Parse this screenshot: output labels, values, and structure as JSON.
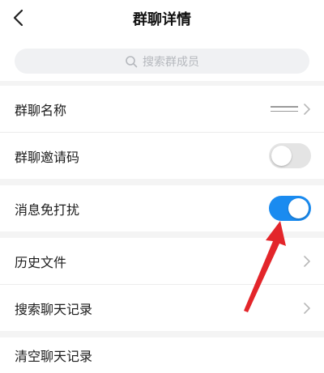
{
  "header": {
    "title": "群聊详情",
    "back_icon": "chevron-left-icon"
  },
  "search": {
    "placeholder": "搜索群成员",
    "icon": "search-icon"
  },
  "rows": {
    "group_name": {
      "label": "群聊名称"
    },
    "invite_code": {
      "label": "群聊邀请码",
      "toggle": "off"
    },
    "do_not_disturb": {
      "label": "消息免打扰",
      "toggle": "on"
    },
    "history_files": {
      "label": "历史文件"
    },
    "search_history": {
      "label": "搜索聊天记录"
    },
    "clear_history": {
      "label": "清空聊天记录"
    }
  },
  "colors": {
    "toggle_on": "#1a8bf0",
    "toggle_off": "#e4e4e4",
    "annotation_arrow": "#e3252a"
  }
}
